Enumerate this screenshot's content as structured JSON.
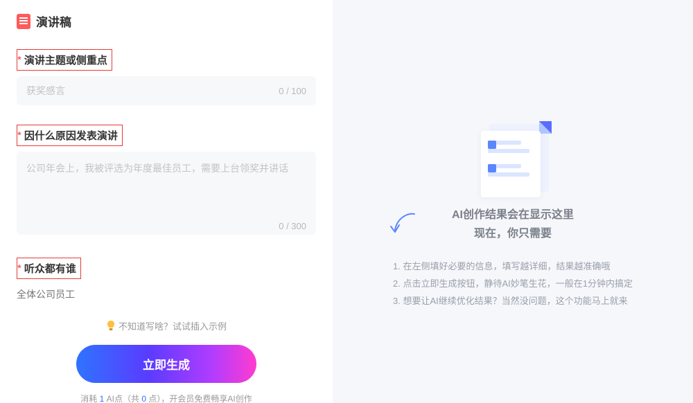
{
  "header": {
    "title": "演讲稿"
  },
  "fields": {
    "f1": {
      "label": "演讲主题或侧重点",
      "placeholder": "获奖感言",
      "counter": "0 / 100"
    },
    "f2": {
      "label": "因什么原因发表演讲",
      "placeholder": "公司年会上，我被评选为年度最佳员工，需要上台领奖并讲话",
      "counter": "0 / 300"
    },
    "f3": {
      "label": "听众都有谁",
      "partial": "全体公司员工"
    }
  },
  "hint": "不知道写啥？试试插入示例",
  "generate_label": "立即生成",
  "cost": {
    "prefix": "消耗 ",
    "n1": "1",
    "mid1": " AI点（共 ",
    "n2": "0",
    "mid2": " 点），",
    "suffix": "开会员免费畅享AI创作"
  },
  "right": {
    "heading_l1": "AI创作结果会在显示这里",
    "heading_l2": "现在，你只需要",
    "tips": [
      "1. 在左侧填好必要的信息，填写越详细，结果越准确哦",
      "2. 点击立即生成按钮，静待AI妙笔生花，一般在1分钟内搞定",
      "3. 想要让AI继续优化结果？当然没问题，这个功能马上就来"
    ]
  }
}
